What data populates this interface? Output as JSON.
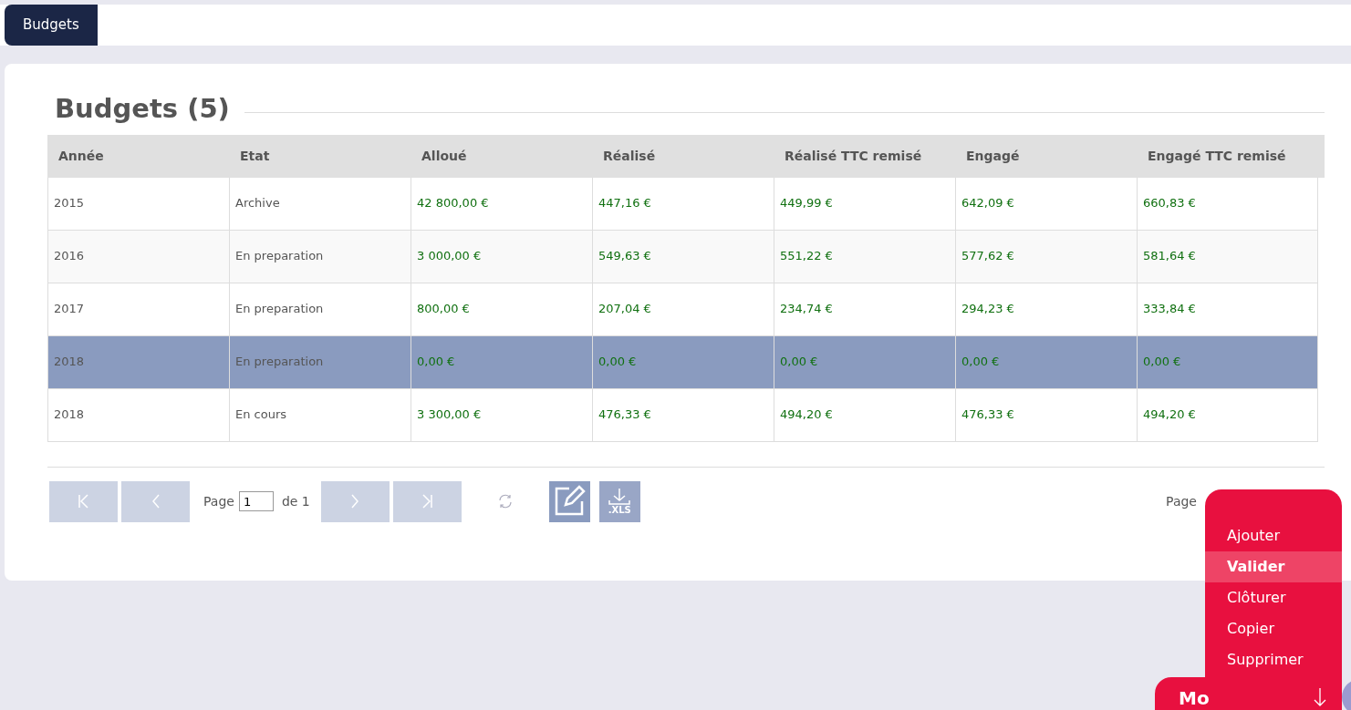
{
  "tabs": [
    {
      "label": "Budgets",
      "selected": true
    }
  ],
  "title": "Budgets (5)",
  "table": {
    "columns": [
      "Année",
      "Etat",
      "Alloué",
      "Réalisé",
      "Réalisé TTC remisé",
      "Engagé",
      "Engagé TTC remisé"
    ],
    "rows": [
      {
        "selected": false,
        "cells": [
          "2015",
          "Archive",
          "42 800,00 €",
          "447,16 €",
          "449,99 €",
          "642,09 €",
          "660,83 €"
        ]
      },
      {
        "selected": false,
        "cells": [
          "2016",
          "En preparation",
          "3 000,00 €",
          "549,63 €",
          "551,22 €",
          "577,62 €",
          "581,64 €"
        ]
      },
      {
        "selected": false,
        "cells": [
          "2017",
          "En preparation",
          "800,00 €",
          "207,04 €",
          "234,74 €",
          "294,23 €",
          "333,84 €"
        ]
      },
      {
        "selected": true,
        "cells": [
          "2018",
          "En preparation",
          "0,00 €",
          "0,00 €",
          "0,00 €",
          "0,00 €",
          "0,00 €"
        ]
      },
      {
        "selected": false,
        "cells": [
          "2018",
          "En cours",
          "3 300,00 €",
          "476,33 €",
          "494,20 €",
          "476,33 €",
          "494,20 €"
        ]
      }
    ]
  },
  "pager": {
    "page_label": "Page",
    "page_value": "1",
    "of_label": "de 1",
    "xls_label": ".XLS",
    "right_label": "Page"
  },
  "menu": {
    "items": [
      {
        "label": "Ajouter",
        "selected": false
      },
      {
        "label": "Valider",
        "selected": true
      },
      {
        "label": "Clôturer",
        "selected": false
      },
      {
        "label": "Copier",
        "selected": false
      },
      {
        "label": "Supprimer",
        "selected": false
      }
    ],
    "button_label": "Mo"
  }
}
